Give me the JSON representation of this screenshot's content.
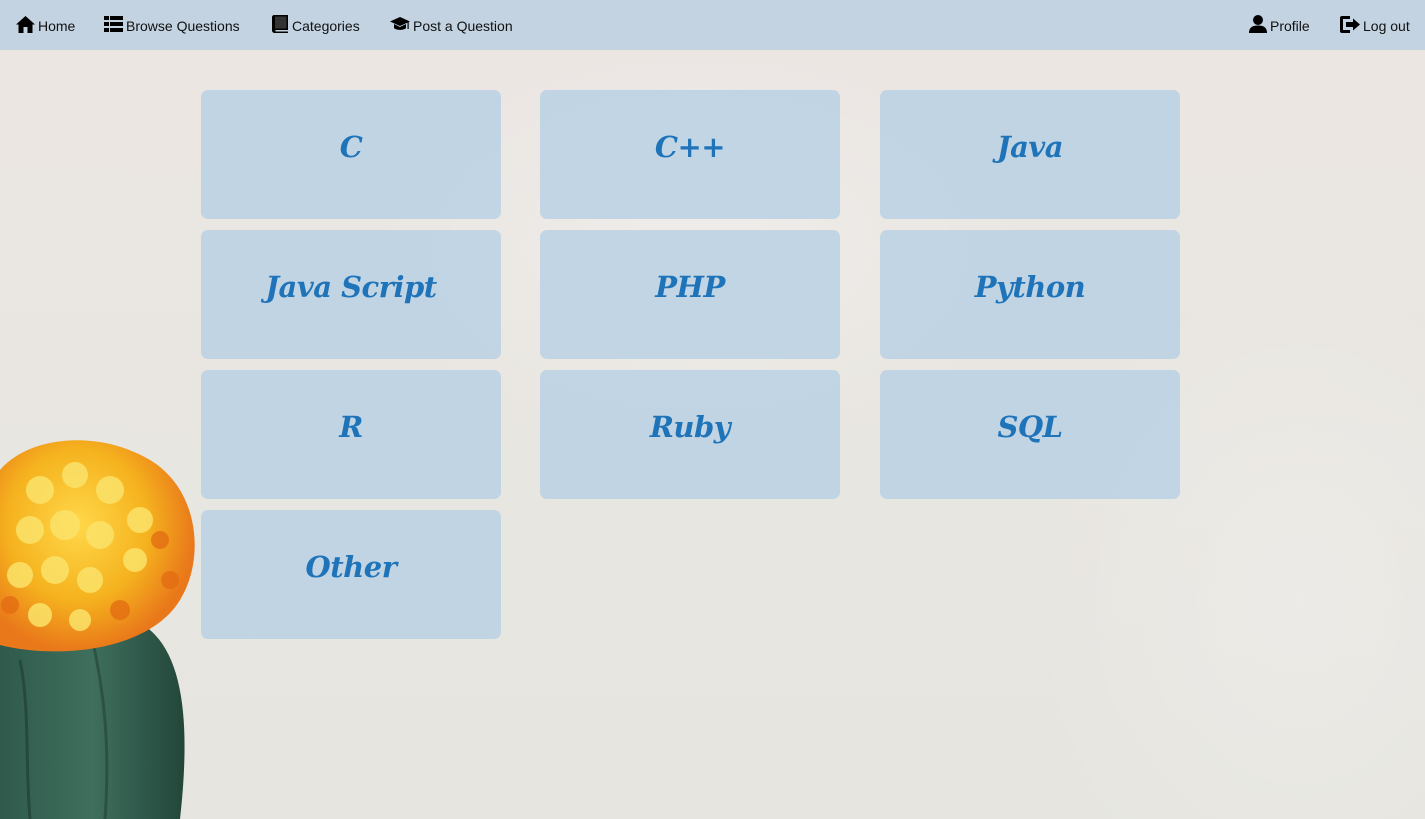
{
  "nav": {
    "home": {
      "label": "Home",
      "icon": "home-icon"
    },
    "browse": {
      "label": "Browse Questions",
      "icon": "list-icon"
    },
    "categories": {
      "label": "Categories",
      "icon": "book-icon"
    },
    "post": {
      "label": "Post a Question",
      "icon": "graduation-cap-icon"
    },
    "profile": {
      "label": "Profile",
      "icon": "user-icon"
    },
    "logout": {
      "label": "Log out",
      "icon": "logout-icon"
    }
  },
  "categories": [
    {
      "label": "C"
    },
    {
      "label": "C++"
    },
    {
      "label": "Java"
    },
    {
      "label": "Java Script"
    },
    {
      "label": "PHP"
    },
    {
      "label": "Python"
    },
    {
      "label": "R"
    },
    {
      "label": "Ruby"
    },
    {
      "label": "SQL"
    },
    {
      "label": "Other"
    }
  ],
  "colors": {
    "navbar": "#c3d3e1",
    "card": "#bdd3e4",
    "card_text": "#1f74b9"
  }
}
